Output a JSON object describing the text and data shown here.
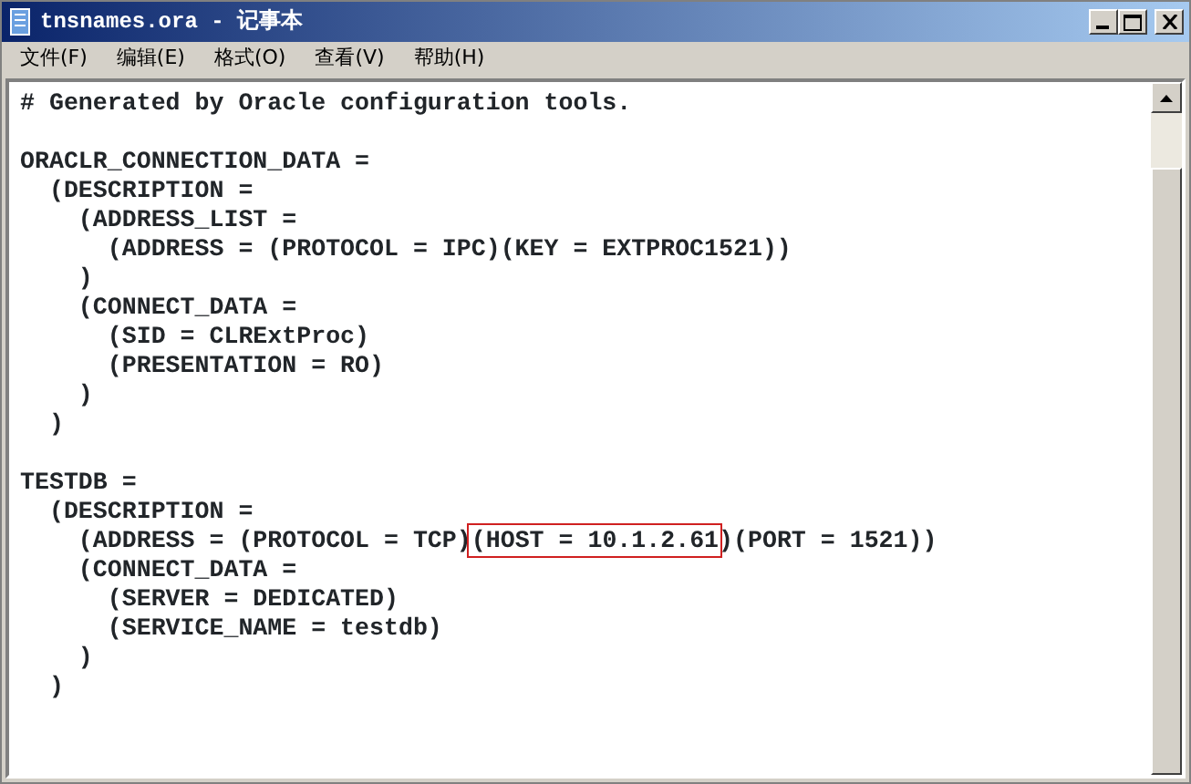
{
  "window": {
    "title": "tnsnames.ora - 记事本"
  },
  "menu": [
    "文件(F)",
    "编辑(E)",
    "格式(O)",
    "查看(V)",
    "帮助(H)"
  ],
  "lines": [
    {
      "kind": "text",
      "text": "# Generated by Oracle configuration tools."
    },
    {
      "kind": "blank"
    },
    {
      "kind": "text",
      "text": "ORACLR_CONNECTION_DATA ="
    },
    {
      "kind": "text",
      "text": "  (DESCRIPTION ="
    },
    {
      "kind": "text",
      "text": "    (ADDRESS_LIST ="
    },
    {
      "kind": "text",
      "text": "      (ADDRESS = (PROTOCOL = IPC)(KEY = EXTPROC1521))"
    },
    {
      "kind": "text",
      "text": "    )"
    },
    {
      "kind": "text",
      "text": "    (CONNECT_DATA ="
    },
    {
      "kind": "text",
      "text": "      (SID = CLRExtProc)"
    },
    {
      "kind": "text",
      "text": "      (PRESENTATION = RO)"
    },
    {
      "kind": "text",
      "text": "    )"
    },
    {
      "kind": "text",
      "text": "  )"
    },
    {
      "kind": "blank"
    },
    {
      "kind": "text",
      "text": "TESTDB ="
    },
    {
      "kind": "text",
      "text": "  (DESCRIPTION ="
    },
    {
      "kind": "annotated",
      "before": "    (ADDRESS = (PROTOCOL = TCP)",
      "boxed": "(HOST = 10.1.2.61",
      "after": ")(PORT = 1521))"
    },
    {
      "kind": "text",
      "text": "    (CONNECT_DATA ="
    },
    {
      "kind": "text",
      "text": "      (SERVER = DEDICATED)"
    },
    {
      "kind": "text",
      "text": "      (SERVICE_NAME = testdb)"
    },
    {
      "kind": "text",
      "text": "    )"
    },
    {
      "kind": "text",
      "text": "  )"
    }
  ]
}
